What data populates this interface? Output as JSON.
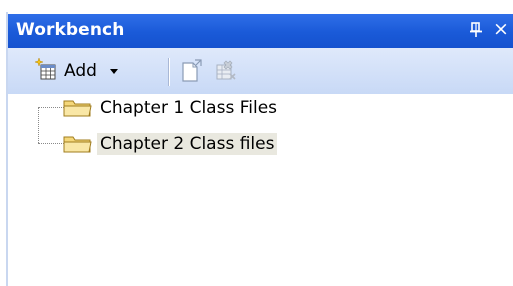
{
  "panel": {
    "title": "Workbench",
    "pin_icon": "pin-icon",
    "close_label": "×"
  },
  "toolbar": {
    "add_label": "Add",
    "add_icon": "add-item-icon",
    "open_icon": "open-document-icon",
    "remove_icon": "remove-disabled-icon"
  },
  "tree": {
    "items": [
      {
        "label": "Chapter 1 Class Files",
        "icon": "folder-icon",
        "selected": false
      },
      {
        "label": "Chapter 2 Class files",
        "icon": "folder-icon",
        "selected": true
      }
    ]
  },
  "colors": {
    "titlebar": "#1a5ad8",
    "toolbar": "#c8d9f6",
    "selection": "#e9e8df"
  }
}
